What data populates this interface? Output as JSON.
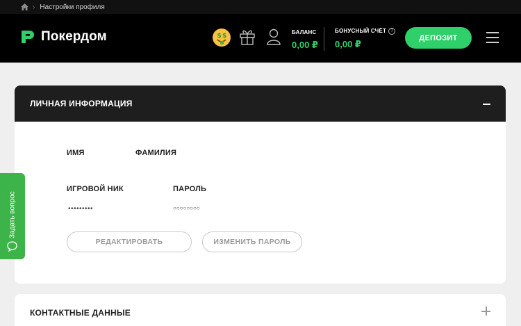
{
  "breadcrumb": {
    "current": "Настройки профиля"
  },
  "header": {
    "logo_text": "Покердом",
    "balance": {
      "label": "БАЛАНС",
      "value": "0,00 ₽"
    },
    "bonus": {
      "label": "БОНУСНЫЙ СЧЁТ",
      "value": "0,00 ₽",
      "help": "?"
    },
    "deposit_label": "ДЕПОЗИТ",
    "icons": [
      "money-face-icon",
      "gift-icon",
      "user-icon",
      "menu-icon"
    ]
  },
  "personal": {
    "title": "ЛИЧНАЯ ИНФОРМАЦИЯ",
    "first_name_label": "ИМЯ",
    "last_name_label": "ФАМИЛИЯ",
    "nick_label": "ИГРОВОЙ НИК",
    "nick_value": "•••••••••",
    "password_label": "ПАРОЛЬ",
    "password_value": "○○○○○○○○",
    "edit_label": "РЕДАКТИРОВАТЬ",
    "change_password_label": "ИЗМЕНИТЬ ПАРОЛЬ"
  },
  "contacts": {
    "title": "КОНТАКТНЫЕ ДАННЫЕ"
  },
  "ask": {
    "label": "Задать вопрос"
  },
  "colors": {
    "accent": "#2fd06a",
    "header_bg": "#000000",
    "card_header_bg": "#1e1e1e",
    "ask_bg": "#3db449"
  }
}
